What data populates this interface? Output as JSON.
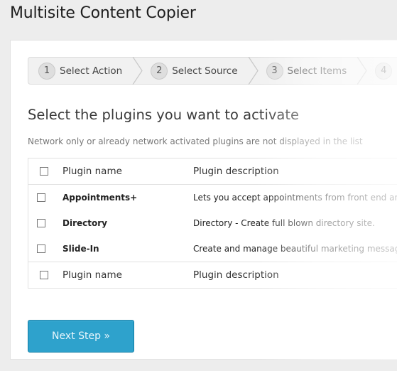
{
  "page": {
    "title": "Multisite Content Copier"
  },
  "wizard": {
    "steps": [
      {
        "number": "1",
        "label": "Select Action"
      },
      {
        "number": "2",
        "label": "Select Source"
      },
      {
        "number": "3",
        "label": "Select Items"
      },
      {
        "number": "4",
        "label": ""
      }
    ]
  },
  "section": {
    "title": "Select the plugins you want to activate",
    "note": "Network only or already network activated plugins are not displayed in the list"
  },
  "table": {
    "columns": {
      "name": "Plugin name",
      "description": "Plugin description"
    },
    "rows": [
      {
        "name": "Appointments+",
        "description": "Lets you accept appointments from front end and manage them"
      },
      {
        "name": "Directory",
        "description": "Directory - Create full blown directory site."
      },
      {
        "name": "Slide-In",
        "description": "Create and manage beautiful marketing messages"
      }
    ]
  },
  "actions": {
    "next_label": "Next Step »"
  },
  "colors": {
    "primary_button": "#2ea2cc",
    "background": "#ededed"
  }
}
